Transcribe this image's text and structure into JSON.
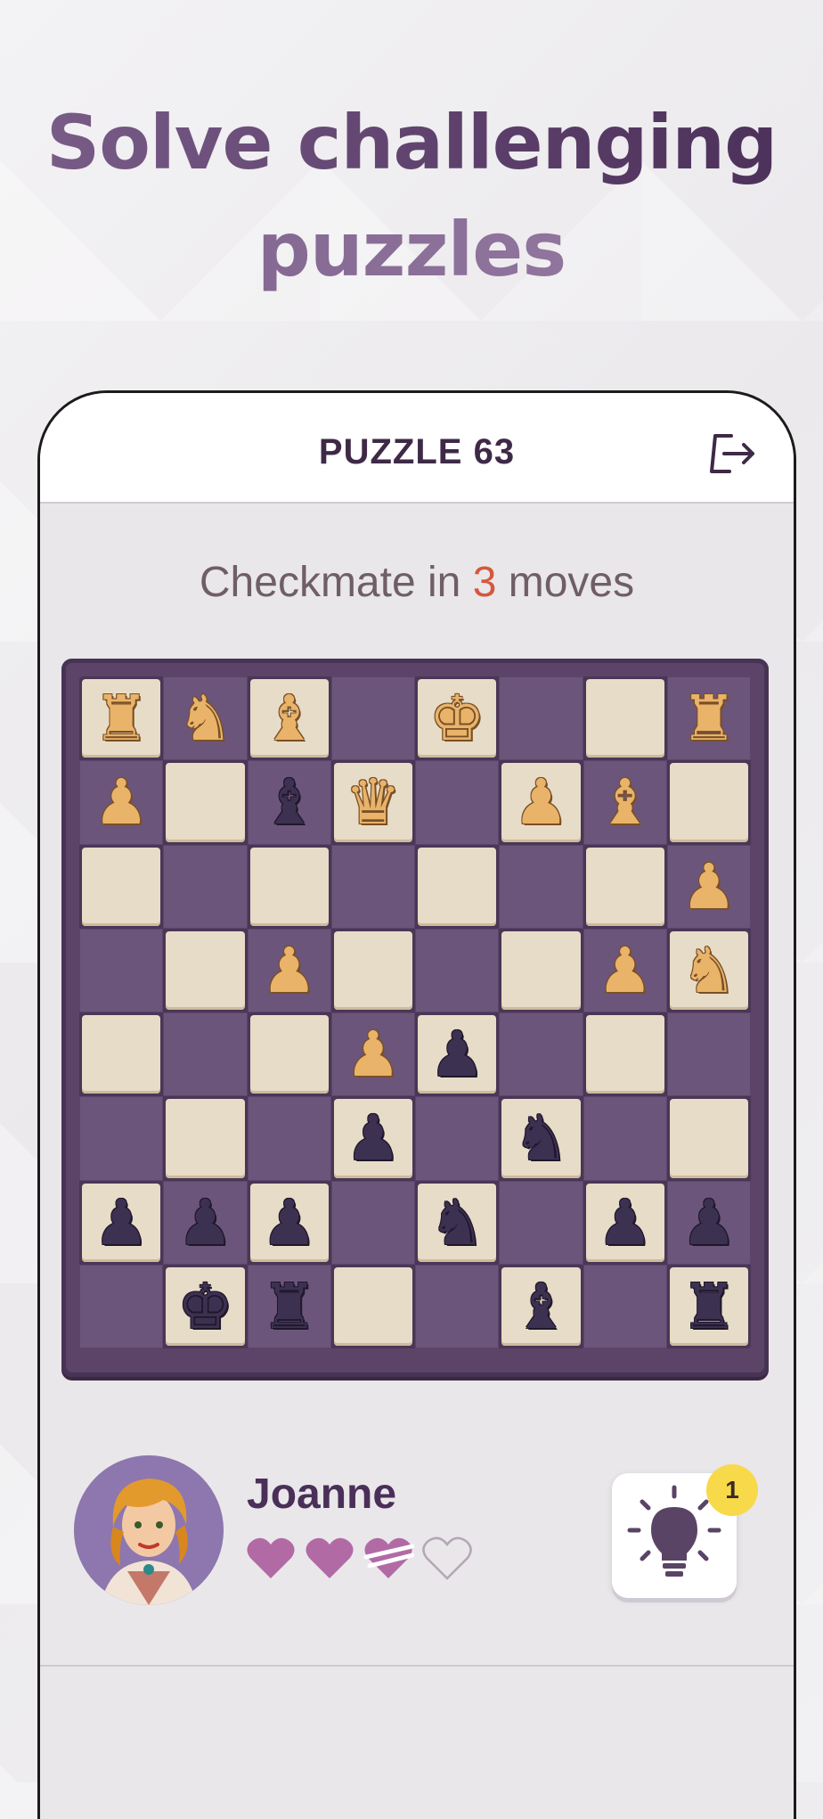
{
  "headline": {
    "line1": "Solve challenging",
    "line2": "puzzles"
  },
  "header": {
    "title": "PUZZLE 63",
    "exit_icon": "exit-icon"
  },
  "subtitle": {
    "prefix": "Checkmate in ",
    "number": "3",
    "suffix": " moves",
    "number_color": "#d4583c"
  },
  "board": {
    "rows": [
      [
        "wR",
        "wN",
        "wB",
        "",
        "wK",
        "",
        "",
        "wR"
      ],
      [
        "wP",
        "",
        "bB",
        "wQ",
        "",
        "wP",
        "wB",
        ""
      ],
      [
        "",
        "",
        "",
        "",
        "",
        "",
        "",
        "wP"
      ],
      [
        "",
        "",
        "wP",
        "",
        "",
        "",
        "wP",
        "wN"
      ],
      [
        "",
        "",
        "",
        "wP",
        "bP",
        "",
        "",
        ""
      ],
      [
        "",
        "",
        "",
        "bP",
        "",
        "bN",
        "",
        ""
      ],
      [
        "bP",
        "bP",
        "bP",
        "",
        "bN",
        "",
        "bP",
        "bP"
      ],
      [
        "",
        "bK",
        "bR",
        "",
        "",
        "bB",
        "",
        "bR"
      ]
    ],
    "light_color": "#e7dcc7",
    "dark_color": "#6c557a"
  },
  "player": {
    "name": "Joanne",
    "avatar_icon": "avatar-portrait",
    "hearts": [
      "full",
      "full",
      "half",
      "empty"
    ],
    "heart_color": "#b26aa5"
  },
  "hint": {
    "icon": "lightbulb-icon",
    "badge_count": "1",
    "badge_color": "#f8d94a"
  }
}
